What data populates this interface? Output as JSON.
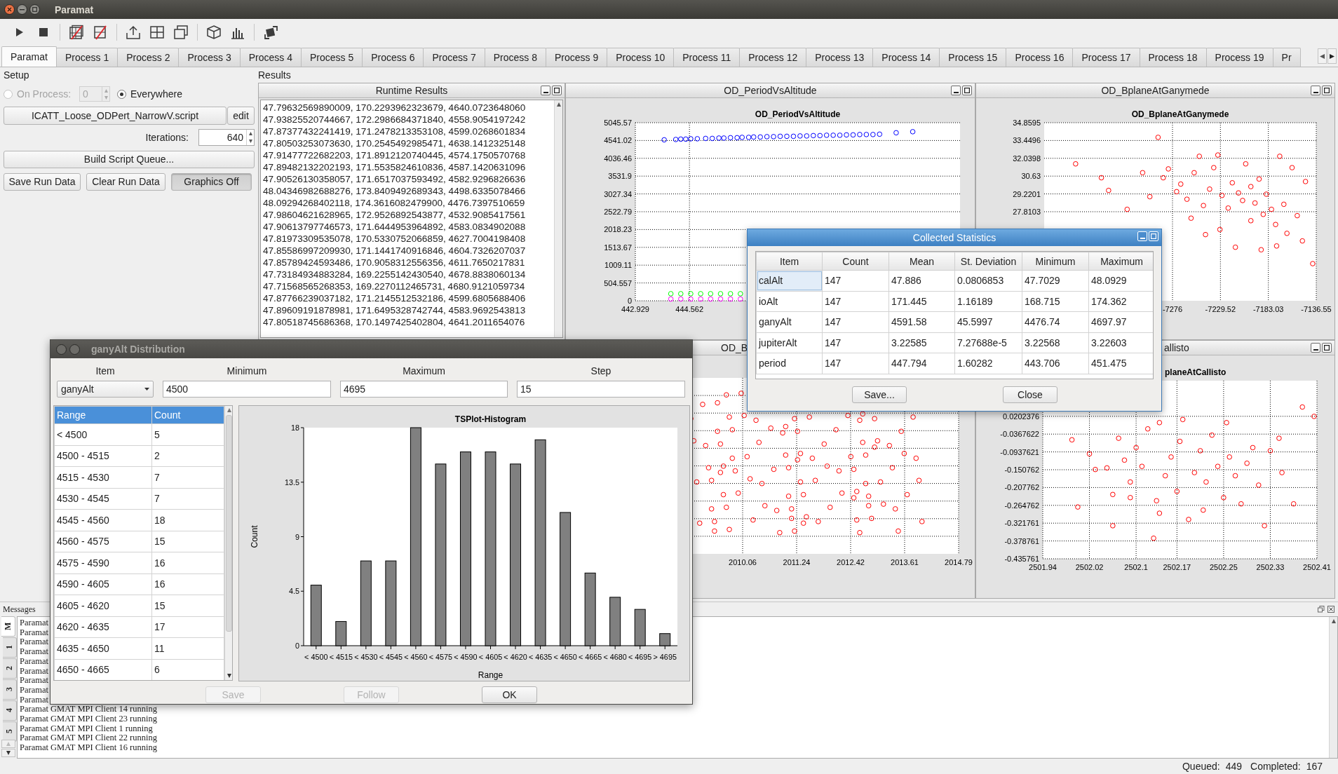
{
  "window": {
    "title": "Paramat"
  },
  "tabs": [
    {
      "label": "Paramat",
      "selected": true
    },
    {
      "label": "Process 1",
      "selected": false
    },
    {
      "label": "Process 2",
      "selected": false
    },
    {
      "label": "Process 3",
      "selected": false
    },
    {
      "label": "Process 4",
      "selected": false
    },
    {
      "label": "Process 5",
      "selected": false
    },
    {
      "label": "Process 6",
      "selected": false
    },
    {
      "label": "Process 7",
      "selected": false
    },
    {
      "label": "Process 8",
      "selected": false
    },
    {
      "label": "Process 9",
      "selected": false
    },
    {
      "label": "Process 10",
      "selected": false
    },
    {
      "label": "Process 11",
      "selected": false
    },
    {
      "label": "Process 12",
      "selected": false
    },
    {
      "label": "Process 13",
      "selected": false
    },
    {
      "label": "Process 14",
      "selected": false
    },
    {
      "label": "Process 15",
      "selected": false
    },
    {
      "label": "Process 16",
      "selected": false
    },
    {
      "label": "Process 17",
      "selected": false
    },
    {
      "label": "Process 18",
      "selected": false
    },
    {
      "label": "Process 19",
      "selected": false
    },
    {
      "label": "Pr",
      "selected": false
    }
  ],
  "setup": {
    "title": "Setup",
    "on_process": {
      "label": "On Process:",
      "selected": false,
      "disabled": true,
      "value": "0"
    },
    "everywhere": {
      "label": "Everywhere",
      "selected": true
    },
    "script": "ICATT_Loose_ODPert_NarrowV.script",
    "edit": "edit",
    "iterations": {
      "label": "Iterations:",
      "value": "640"
    },
    "build": "Build Script Queue...",
    "buttons": [
      {
        "label": "Save Run Data",
        "pressed": false
      },
      {
        "label": "Clear Run Data",
        "pressed": false
      },
      {
        "label": "Graphics Off",
        "pressed": true
      }
    ]
  },
  "results": {
    "title": "Results",
    "runtime": {
      "title": "Runtime Results",
      "lines": [
        "47.79632569890009, 170.2293962323679, 4640.0723648060",
        "47.93825520744667, 172.2986684371840, 4558.9054197242",
        "47.87377432241419, 171.2478213353108, 4599.0268601834",
        "47.80503253073630, 170.2545492985471, 4638.1412325148",
        "47.91477722682203, 171.8912120740445, 4574.1750570768",
        "47.89482132202193, 171.5535824610836, 4587.1420631096",
        "47.90526130358057, 171.6517037593492, 4582.9296826636",
        "48.04346982688276, 173.8409492689343, 4498.6335078466",
        "48.09294268402118, 174.3616082479900, 4476.7397510659",
        "47.98604621628965, 172.9526892543877, 4532.9085417561",
        "47.90613797746573, 171.6444953964892, 4583.0834902088",
        "47.81973309535078, 170.5330752066859, 4627.7004198408",
        "47.85586997209930, 171.1441740916846, 4604.7326207037",
        "47.85789424593486, 170.9058312556356, 4611.7650217831",
        "47.73184934883284, 169.2255142430540, 4678.8838060134",
        "47.71568565268353, 169.2270112465731, 4680.9121059734",
        "47.87766239037182, 171.2145512532186, 4599.6805688406",
        "47.89609191878981, 171.6495328742744, 4583.9692543813",
        "47.80518745686368, 170.1497425402804, 4641.2011654076"
      ]
    },
    "plots": [
      {
        "kind": "chart",
        "panel_title": "OD_PeriodVsAltitude",
        "chart_data": {
          "type": "scatter",
          "title": "OD_PeriodVsAltitude",
          "xlim": [
            442.929,
            452.727
          ],
          "ylim": [
            0,
            5045.57
          ],
          "grid": true,
          "xticks": [
            442.929,
            444.562
          ],
          "yticks": [
            5045.57,
            4541.02,
            4036.46,
            3531.9,
            3027.34,
            2522.79,
            2018.23,
            1513.67,
            1009.11,
            504.557,
            0
          ],
          "series": [
            {
              "color": "#0000ff",
              "x": [
                443.8,
                444.15,
                444.3,
                444.45,
                444.6,
                444.8,
                445.05,
                445.25,
                445.45,
                445.6,
                445.8,
                446.0,
                446.15,
                446.35,
                446.5,
                446.7,
                446.9,
                447.1,
                447.3,
                447.5,
                447.7,
                447.9,
                448.1,
                448.3,
                448.5,
                448.7,
                448.9,
                449.1,
                449.3,
                449.5,
                449.7,
                449.9,
                450.1,
                450.3,
                450.8,
                451.3
              ],
              "values": [
                4560,
                4570,
                4580,
                4580,
                4590,
                4590,
                4600,
                4600,
                4610,
                4610,
                4620,
                4620,
                4630,
                4630,
                4640,
                4640,
                4650,
                4650,
                4660,
                4660,
                4660,
                4670,
                4670,
                4680,
                4680,
                4690,
                4690,
                4690,
                4700,
                4700,
                4710,
                4710,
                4710,
                4720,
                4760,
                4790
              ]
            },
            {
              "color": "#00ff00",
              "x": [
                444.0,
                444.3,
                444.6,
                444.9,
                445.2,
                445.5,
                445.8,
                446.1
              ],
              "values": [
                200,
                200,
                200,
                200,
                200,
                200,
                200,
                200
              ]
            },
            {
              "color": "#ff00ff",
              "x": [
                444.0,
                444.3,
                444.6,
                444.9,
                445.2,
                445.5,
                445.8,
                446.1
              ],
              "values": [
                50,
                50,
                50,
                50,
                50,
                50,
                50,
                50
              ]
            }
          ]
        }
      },
      {
        "kind": "chart",
        "panel_title": "OD_BplaneAtGanymede",
        "chart_data": {
          "type": "scatter",
          "title": "OD_BplaneAtGanymede",
          "xlim": [
            -7400.5,
            -7136.55
          ],
          "ylim": [
            20.761,
            34.8595
          ],
          "grid": true,
          "xticks": [
            -7276,
            -7229.52,
            -7183.03,
            -7136.55
          ],
          "yticks": [
            34.8595,
            33.4496,
            32.0398,
            30.63,
            29.2201,
            27.8103
          ],
          "series": [
            {
              "color": "#ff0000",
              "x": [
                -7370,
                -7345,
                -7338,
                -7320,
                -7305,
                -7298,
                -7290,
                -7285,
                -7280,
                -7272,
                -7268,
                -7262,
                -7255,
                -7250,
                -7246,
                -7240,
                -7236,
                -7232,
                -7228,
                -7222,
                -7218,
                -7212,
                -7208,
                -7205,
                -7200,
                -7196,
                -7192,
                -7188,
                -7185,
                -7180,
                -7176,
                -7172,
                -7168,
                -7165,
                -7160,
                -7155,
                -7150,
                -7147,
                -7140,
                -7215,
                -7230,
                -7258,
                -7190,
                -7244,
                -7175,
                -7200
              ],
              "values": [
                31.6,
                30.5,
                29.5,
                28.0,
                30.9,
                29.0,
                33.7,
                30.5,
                31.2,
                29.4,
                30.0,
                28.8,
                30.9,
                32.2,
                28.3,
                29.6,
                31.3,
                32.3,
                29.1,
                28.1,
                30.1,
                29.3,
                28.7,
                31.6,
                29.8,
                28.5,
                30.4,
                27.6,
                29.2,
                28.0,
                26.8,
                32.2,
                28.4,
                26.1,
                31.3,
                27.5,
                25.5,
                30.2,
                23.7,
                25.0,
                26.4,
                27.3,
                24.8,
                26.0,
                25.1,
                27.1
              ]
            }
          ]
        }
      },
      {
        "kind": "plot-picture",
        "panel_title": "OD_B",
        "x_tick_labels": [
          "2010.06",
          "2011.24",
          "2012.42",
          "2013.61",
          "2014.79"
        ]
      },
      {
        "kind": "chart",
        "panel_title": "allisto",
        "chart_data": {
          "type": "scatter",
          "title": "planeAtCallisto",
          "xlim": [
            2501.94,
            2502.41
          ],
          "ylim": [
            -0.435761,
            0.134238
          ],
          "grid": true,
          "xticks": [
            2501.94,
            2502.02,
            2502.1,
            2502.17,
            2502.25,
            2502.33,
            2502.41
          ],
          "yticks": [
            0.0202376,
            -0.0367622,
            -0.0937621,
            -0.150762,
            -0.207762,
            -0.264762,
            -0.321761,
            -0.378761,
            -0.435761
          ],
          "series": [
            {
              "color": "#ff0000",
              "x": [
                2501.99,
                2502.0,
                2502.02,
                2502.03,
                2502.05,
                2502.06,
                2502.07,
                2502.08,
                2502.09,
                2502.1,
                2502.11,
                2502.12,
                2502.13,
                2502.135,
                2502.14,
                2502.15,
                2502.16,
                2502.17,
                2502.175,
                2502.18,
                2502.19,
                2502.2,
                2502.21,
                2502.215,
                2502.22,
                2502.23,
                2502.24,
                2502.25,
                2502.255,
                2502.26,
                2502.27,
                2502.28,
                2502.29,
                2502.3,
                2502.31,
                2502.32,
                2502.33,
                2502.345,
                2502.35,
                2502.37,
                2502.385,
                2502.405,
                2502.06,
                2502.14,
                2502.09
              ],
              "values": [
                -0.055,
                -0.27,
                -0.1,
                -0.15,
                -0.145,
                -0.23,
                -0.05,
                -0.12,
                -0.19,
                -0.08,
                -0.14,
                -0.02,
                -0.37,
                -0.25,
                0.0,
                -0.17,
                -0.11,
                -0.22,
                -0.06,
                0.01,
                -0.31,
                -0.16,
                -0.09,
                -0.28,
                -0.19,
                -0.04,
                -0.14,
                -0.24,
                0.0,
                -0.11,
                -0.17,
                -0.26,
                -0.13,
                -0.08,
                -0.2,
                -0.33,
                -0.09,
                -0.05,
                -0.16,
                -0.26,
                0.05,
                0.02,
                -0.33,
                -0.29,
                -0.24
              ]
            }
          ]
        }
      }
    ]
  },
  "messages": {
    "title": "Messages",
    "tabs": [
      {
        "label": "M",
        "selected": true
      },
      {
        "label": "1",
        "selected": false
      },
      {
        "label": "2",
        "selected": false
      },
      {
        "label": "3",
        "selected": false
      },
      {
        "label": "4",
        "selected": false
      },
      {
        "label": "5",
        "selected": false
      }
    ],
    "lines": [
      "Paramat",
      "Paramat",
      "Paramat",
      "Paramat",
      "Paramat",
      "Paramat",
      "Paramat",
      "Paramat",
      "Paramat",
      "Paramat GMAT MPI Client 14 running",
      "Paramat GMAT MPI Client 23 running",
      "Paramat GMAT MPI Client 1 running",
      "Paramat GMAT MPI Client 22 running",
      "Paramat GMAT MPI Client 16 running"
    ]
  },
  "status": {
    "queued_label": "Queued:",
    "queued": "449",
    "completed_label": "Completed:",
    "completed": "167"
  },
  "stats_dialog": {
    "title": "Collected Statistics",
    "columns": [
      "Item",
      "Count",
      "Mean",
      "St. Deviation",
      "Minimum",
      "Maximum"
    ],
    "rows": [
      {
        "focused": true,
        "cells": [
          "calAlt",
          "147",
          "47.886",
          "0.0806853",
          "47.7029",
          "48.0929"
        ]
      },
      {
        "focused": false,
        "cells": [
          "ioAlt",
          "147",
          "171.445",
          "1.16189",
          "168.715",
          "174.362"
        ]
      },
      {
        "focused": false,
        "cells": [
          "ganyAlt",
          "147",
          "4591.58",
          "45.5997",
          "4476.74",
          "4697.97"
        ]
      },
      {
        "focused": false,
        "cells": [
          "jupiterAlt",
          "147",
          "3.22585",
          "7.27688e-5",
          "3.22568",
          "3.22603"
        ]
      },
      {
        "focused": false,
        "cells": [
          "period",
          "147",
          "447.794",
          "1.60282",
          "443.706",
          "451.475"
        ]
      }
    ],
    "buttons": [
      "Save...",
      "Close"
    ]
  },
  "distribution_dialog": {
    "title": "ganyAlt Distribution",
    "fields": [
      {
        "label": "Item",
        "kind": "combo",
        "value": "ganyAlt"
      },
      {
        "label": "Minimum",
        "kind": "text",
        "value": "4500"
      },
      {
        "label": "Maximum",
        "kind": "text",
        "value": "4695"
      },
      {
        "label": "Step",
        "kind": "text",
        "value": "15"
      }
    ],
    "table": {
      "columns": [
        "Range",
        "Count"
      ],
      "rows": [
        [
          "< 4500",
          "5"
        ],
        [
          "4500 - 4515",
          "2"
        ],
        [
          "4515 - 4530",
          "7"
        ],
        [
          "4530 - 4545",
          "7"
        ],
        [
          "4545 - 4560",
          "18"
        ],
        [
          "4560 - 4575",
          "15"
        ],
        [
          "4575 - 4590",
          "16"
        ],
        [
          "4590 - 4605",
          "16"
        ],
        [
          "4605 - 4620",
          "15"
        ],
        [
          "4620 - 4635",
          "17"
        ],
        [
          "4635 - 4650",
          "11"
        ],
        [
          "4650 - 4665",
          "6"
        ]
      ]
    },
    "chart_data": {
      "type": "bar",
      "title": "TSPlot-Histogram",
      "xlabel": "Range",
      "ylabel": "Count",
      "categories": [
        "< 4500",
        "< 4515",
        "< 4530",
        "< 4545",
        "< 4560",
        "< 4575",
        "< 4590",
        "< 4605",
        "< 4620",
        "< 4635",
        "< 4650",
        "< 4665",
        "< 4680",
        "< 4695",
        "> 4695"
      ],
      "values": [
        5,
        2,
        7,
        7,
        18,
        15,
        16,
        16,
        15,
        17,
        11,
        6,
        4,
        3,
        1
      ],
      "ylim": [
        0,
        18
      ],
      "yticks": [
        0,
        4.5,
        9,
        13.5,
        18
      ]
    },
    "buttons": [
      {
        "label": "Save",
        "disabled": true
      },
      {
        "label": "Follow",
        "disabled": true
      },
      {
        "label": "OK",
        "disabled": false
      }
    ]
  }
}
